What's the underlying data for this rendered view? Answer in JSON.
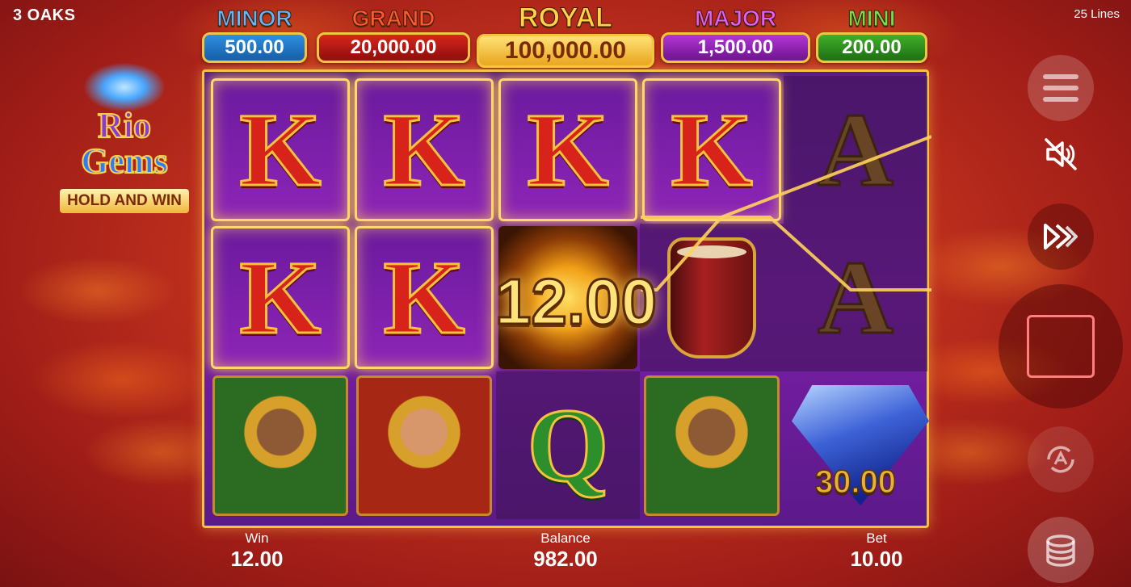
{
  "header": {
    "brand": "3 OAKS",
    "lines": "25 Lines"
  },
  "jackpots": [
    {
      "key": "minor",
      "title": "MINOR",
      "value": "500.00",
      "color": "#2f8fe0"
    },
    {
      "key": "grand",
      "title": "GRAND",
      "value": "20,000.00",
      "color": "#d6261c"
    },
    {
      "key": "royal",
      "title": "ROYAL",
      "value": "100,000.00",
      "color": "#f3c442"
    },
    {
      "key": "major",
      "title": "MAJOR",
      "value": "1,500.00",
      "color": "#b437d6"
    },
    {
      "key": "mini",
      "title": "MINI",
      "value": "200.00",
      "color": "#41b02a"
    }
  ],
  "logo": {
    "line1": "Rio",
    "line2": "Gems",
    "tagline": "HOLD AND WIN"
  },
  "reels": {
    "grid": [
      [
        "K",
        "K",
        "K",
        "K",
        "A"
      ],
      [
        "K",
        "K",
        "burst",
        "drum",
        "A"
      ],
      [
        "dancer-green",
        "dancer-red",
        "Q",
        "dancer-green",
        "gem"
      ]
    ],
    "gem_value": "30.00",
    "win_amount": "12.00"
  },
  "footer": {
    "win_label": "Win",
    "win_value": "12.00",
    "balance_label": "Balance",
    "balance_value": "982.00",
    "bet_label": "Bet",
    "bet_value": "10.00"
  },
  "controls": {
    "icons": [
      "menu-icon",
      "sound-off-icon",
      "turbo-icon",
      "stop-icon",
      "autoplay-icon",
      "coins-icon"
    ]
  }
}
